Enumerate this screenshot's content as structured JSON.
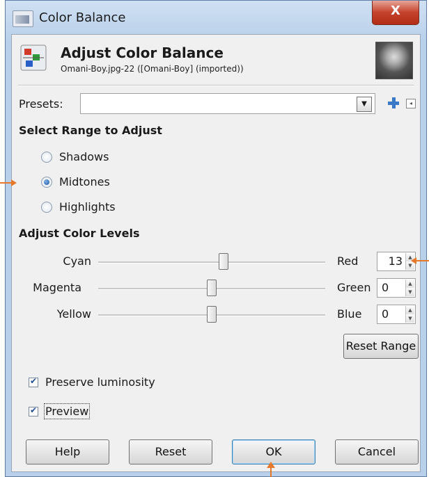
{
  "window": {
    "title": "Color Balance",
    "close_label": "X"
  },
  "header": {
    "title": "Adjust Color Balance",
    "subtitle": "Omani-Boy.jpg-22 ([Omani-Boy] (imported))"
  },
  "presets": {
    "label": "Presets:",
    "value": ""
  },
  "range": {
    "heading": "Select Range to Adjust",
    "options": [
      "Shadows",
      "Midtones",
      "Highlights"
    ],
    "selected": "Midtones"
  },
  "levels": {
    "heading": "Adjust Color Levels",
    "rows": [
      {
        "left": "Cyan",
        "right": "Red",
        "value": "13",
        "level": 13
      },
      {
        "left": "Magenta",
        "right": "Green",
        "value": "0",
        "level": 0
      },
      {
        "left": "Yellow",
        "right": "Blue",
        "value": "0",
        "level": 0
      }
    ],
    "reset_range": "Reset Range"
  },
  "options": {
    "preserve_luminosity": "Preserve luminosity",
    "preview": "Preview"
  },
  "buttons": {
    "help": "Help",
    "reset": "Reset",
    "ok": "OK",
    "cancel": "Cancel"
  },
  "colors": {
    "accent_arrow": "#e6782b",
    "close_button": "#c4412b"
  }
}
